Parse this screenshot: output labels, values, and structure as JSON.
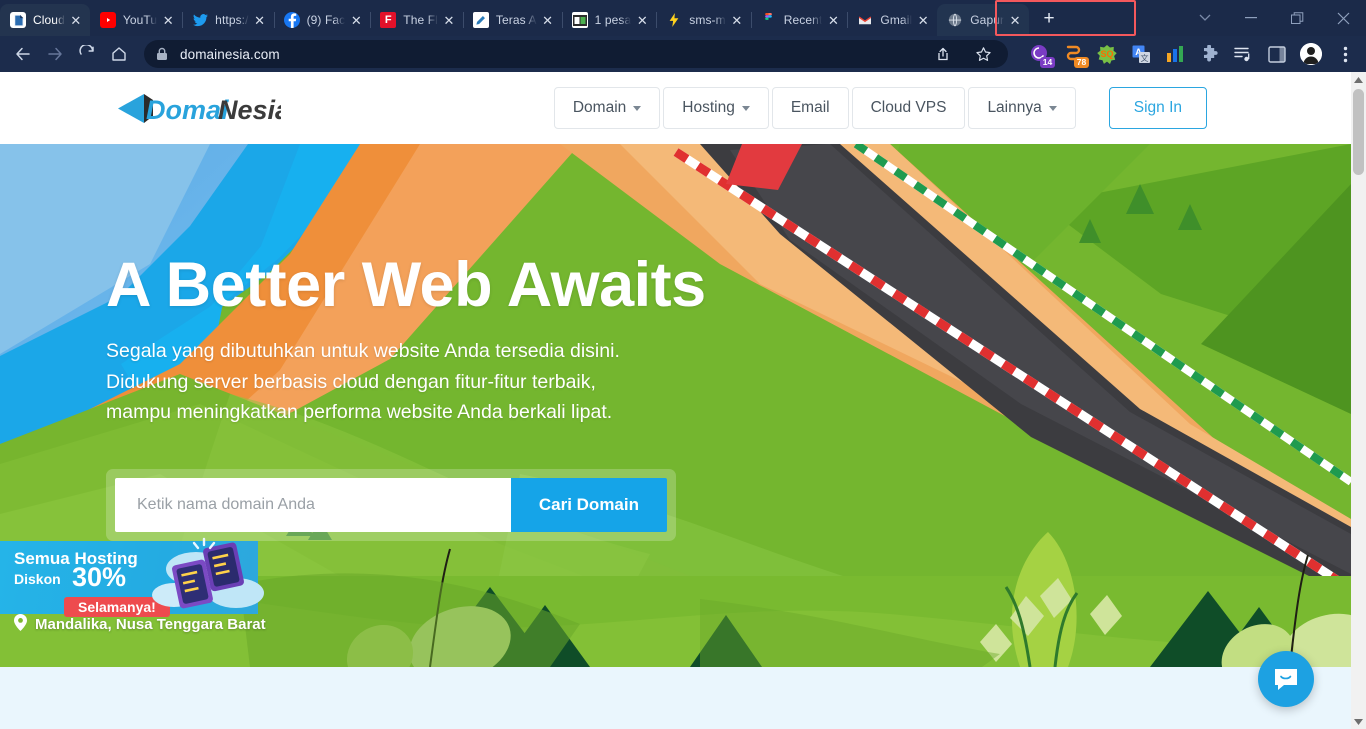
{
  "browser": {
    "tabs": [
      {
        "label": "Cloud",
        "icon": "cloud-document-icon",
        "active": false
      },
      {
        "label": "YouTu",
        "icon": "youtube-icon",
        "active": false
      },
      {
        "label": "https:/",
        "icon": "twitter-icon",
        "active": false
      },
      {
        "label": "(9) Fac",
        "icon": "facebook-icon",
        "active": false
      },
      {
        "label": "The Fl",
        "icon": "flaticon-icon",
        "active": false
      },
      {
        "label": "Teras A",
        "icon": "blog-pen-icon",
        "active": false
      },
      {
        "label": "1 pesa",
        "icon": "mail-window-icon",
        "active": false
      },
      {
        "label": "sms-m",
        "icon": "lightning-icon",
        "active": false
      },
      {
        "label": "Recent",
        "icon": "figma-icon",
        "active": false
      },
      {
        "label": "Gmail",
        "icon": "gmail-icon",
        "active": false
      },
      {
        "label": "Gapur",
        "icon": "globe-icon",
        "active": true
      }
    ],
    "new_tab_label": "+",
    "close_glyph": "✕",
    "window_controls": [
      "tab-search-chevron",
      "minimize",
      "restore",
      "close"
    ],
    "toolbar": {
      "back": "←",
      "forward": "→",
      "reload": "⟳",
      "home": "⌂",
      "url": "domainesia.com",
      "share_icon": "share-icon",
      "bookmark_icon": "star-icon",
      "extensions": [
        {
          "name": "grammarly-extension",
          "badge": "14",
          "color": "#7a3cc4",
          "badge_color": "#7a3cc4"
        },
        {
          "name": "notification-extension",
          "badge": "78",
          "color": "#f08a24",
          "badge_color": "#f08a24"
        },
        {
          "name": "sq-extension",
          "badge": "",
          "color": "#f3a93c",
          "badge_color": ""
        },
        {
          "name": "translate-extension",
          "badge": "",
          "color": "#4285f4",
          "badge_color": ""
        },
        {
          "name": "analytics-extension",
          "badge": "",
          "color": "#f5a623",
          "badge_color": ""
        },
        {
          "name": "puzzle-extensions-icon",
          "badge": "",
          "color": "#9fb2d0",
          "badge_color": ""
        },
        {
          "name": "reading-list-icon",
          "badge": "",
          "color": "#dde4f0",
          "badge_color": ""
        },
        {
          "name": "side-panel-icon",
          "badge": "",
          "color": "#c3cddd",
          "badge_color": ""
        }
      ],
      "menu_icon": "three-dot-menu-icon"
    },
    "highlight_color": "#f4585c"
  },
  "site": {
    "logo": {
      "primary_text": "Domai",
      "secondary_text": "Nesia",
      "primary_color": "#29a3dc",
      "secondary_color": "#3b3b3b"
    },
    "nav": [
      {
        "label": "Domain",
        "has_caret": true
      },
      {
        "label": "Hosting",
        "has_caret": true
      },
      {
        "label": "Email",
        "has_caret": false
      },
      {
        "label": "Cloud VPS",
        "has_caret": false
      },
      {
        "label": "Lainnya",
        "has_caret": true
      }
    ],
    "signin_label": "Sign In",
    "accent_color": "#2ba6e0"
  },
  "hero": {
    "title": "A Better Web Awaits",
    "subtitle_line1": "Segala yang dibutuhkan untuk website Anda tersedia disini.",
    "subtitle_line2": "Didukung server berbasis cloud dengan fitur-fitur terbaik,",
    "subtitle_line3": "mampu meningkatkan performa website Anda berkali lipat.",
    "search_placeholder": "Ketik nama domain Anda",
    "search_value": "",
    "search_button": "Cari Domain",
    "search_button_color": "#15a4e8"
  },
  "promo": {
    "line1": "Semua Hosting",
    "discount_label": "Diskon",
    "discount_value": "30%",
    "ribbon": "Selamanya!",
    "ribbon_color": "#ee4b4e",
    "banner_color": "#24abe2"
  },
  "location": {
    "icon": "map-pin-icon",
    "text": "Mandalika, Nusa Tenggara Barat"
  },
  "chat": {
    "icon": "chat-bubble-smile-icon",
    "color": "#1da1e2"
  },
  "scrollbar": {
    "up_glyph": "▲",
    "down_glyph": "▼",
    "position": "top"
  }
}
